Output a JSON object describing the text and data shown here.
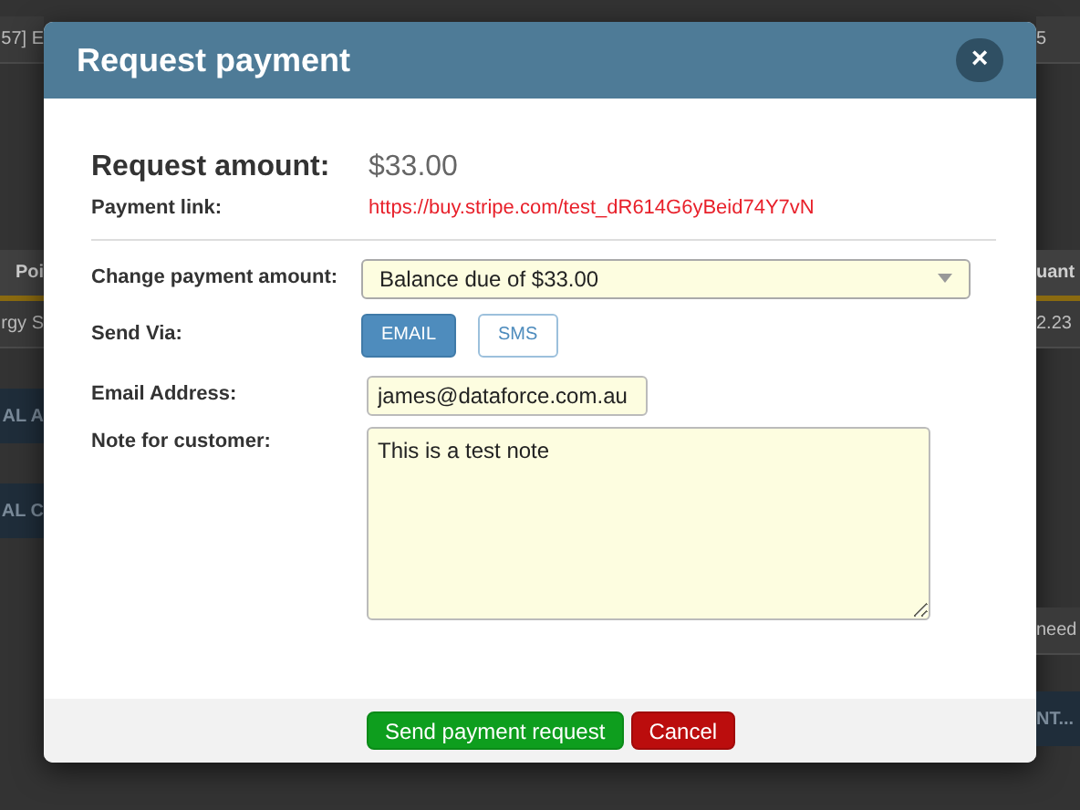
{
  "background": {
    "left": [
      {
        "text": "57] E",
        "kind": "row"
      },
      {
        "text": "Poi",
        "kind": "header"
      },
      {
        "text": "rgy S",
        "kind": "row"
      },
      {
        "text": "AL A",
        "kind": "band"
      },
      {
        "text": "AL C",
        "kind": "band"
      }
    ],
    "right": [
      {
        "text": "5",
        "kind": "row"
      },
      {
        "text": "uant",
        "kind": "header"
      },
      {
        "text": "2.23",
        "kind": "row"
      },
      {
        "text": "need",
        "kind": "row"
      },
      {
        "text": "NT...",
        "kind": "band"
      }
    ]
  },
  "dialog": {
    "title": "Request payment",
    "close": "×",
    "amount_label": "Request amount:",
    "amount": "$33.00",
    "link_label": "Payment link:",
    "link": "https://buy.stripe.com/test_dR614G6yBeid74Y7vN",
    "change_label": "Change payment amount:",
    "change_value": "Balance due of $33.00",
    "send_label": "Send Via:",
    "send_options": [
      {
        "label": "EMAIL",
        "selected": true
      },
      {
        "label": "SMS",
        "selected": false
      }
    ],
    "email_label": "Email Address:",
    "email": "james@dataforce.com.au",
    "note_label": "Note for customer:",
    "note": "This is a test note",
    "buttons": [
      {
        "label": "Send payment request",
        "kind": "primary"
      },
      {
        "label": "Cancel",
        "kind": "danger"
      }
    ]
  }
}
